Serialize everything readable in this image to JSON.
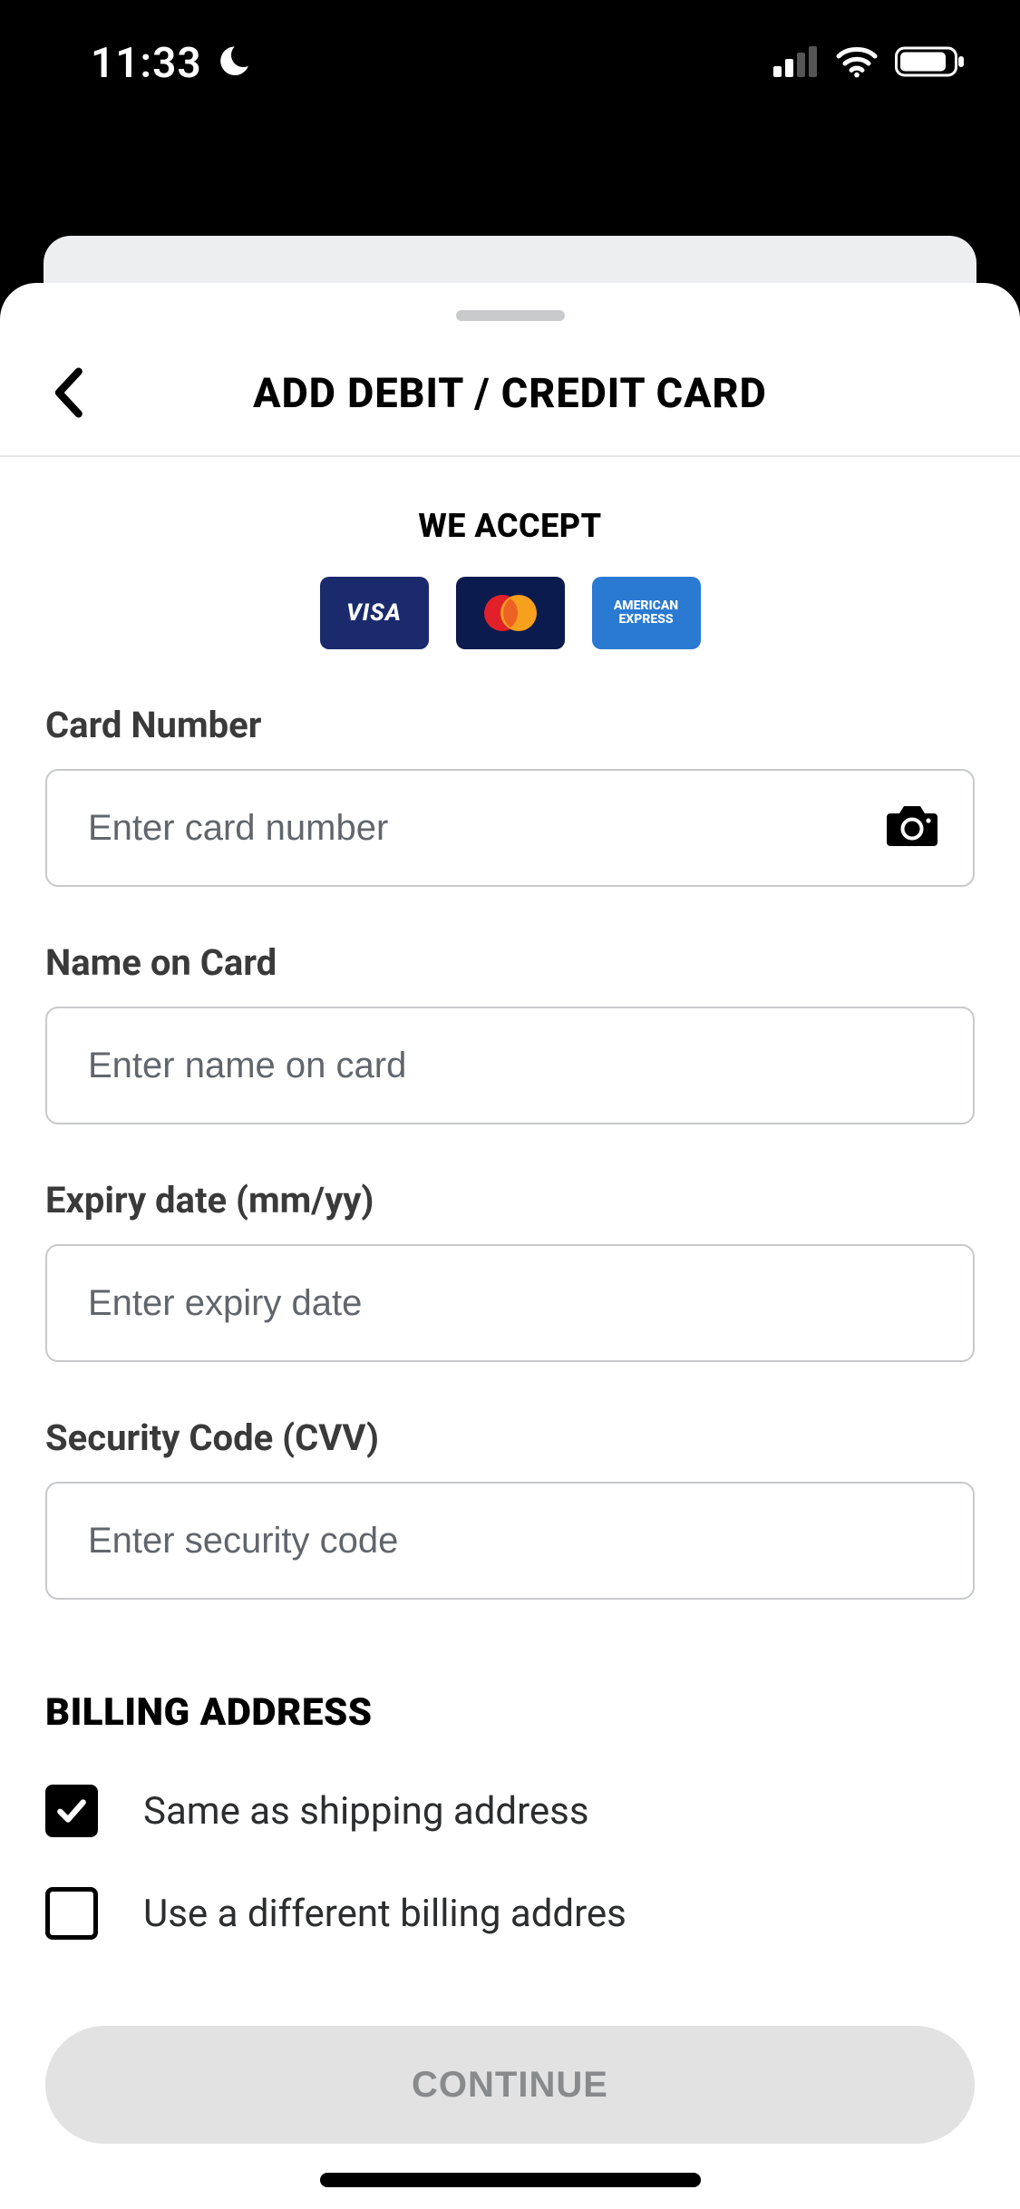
{
  "status": {
    "time": "11:33"
  },
  "header": {
    "title": "ADD DEBIT / CREDIT CARD"
  },
  "accept": {
    "label": "WE ACCEPT",
    "brands": {
      "visa": "VISA",
      "amex_l1": "AMERICAN",
      "amex_l2": "EXPRESS"
    }
  },
  "fields": {
    "card_number": {
      "label": "Card Number",
      "placeholder": "Enter card number",
      "value": ""
    },
    "name": {
      "label": "Name on Card",
      "placeholder": "Enter name on card",
      "value": ""
    },
    "expiry": {
      "label": "Expiry date (mm/yy)",
      "placeholder": "Enter expiry date",
      "value": ""
    },
    "cvv": {
      "label": "Security Code (CVV)",
      "placeholder": "Enter security code",
      "value": ""
    }
  },
  "billing": {
    "title": "BILLING ADDRESS",
    "same_label": "Same as shipping address",
    "diff_label": "Use a different billing addres",
    "same_checked": true,
    "diff_checked": false
  },
  "buttons": {
    "continue": "CONTINUE"
  }
}
